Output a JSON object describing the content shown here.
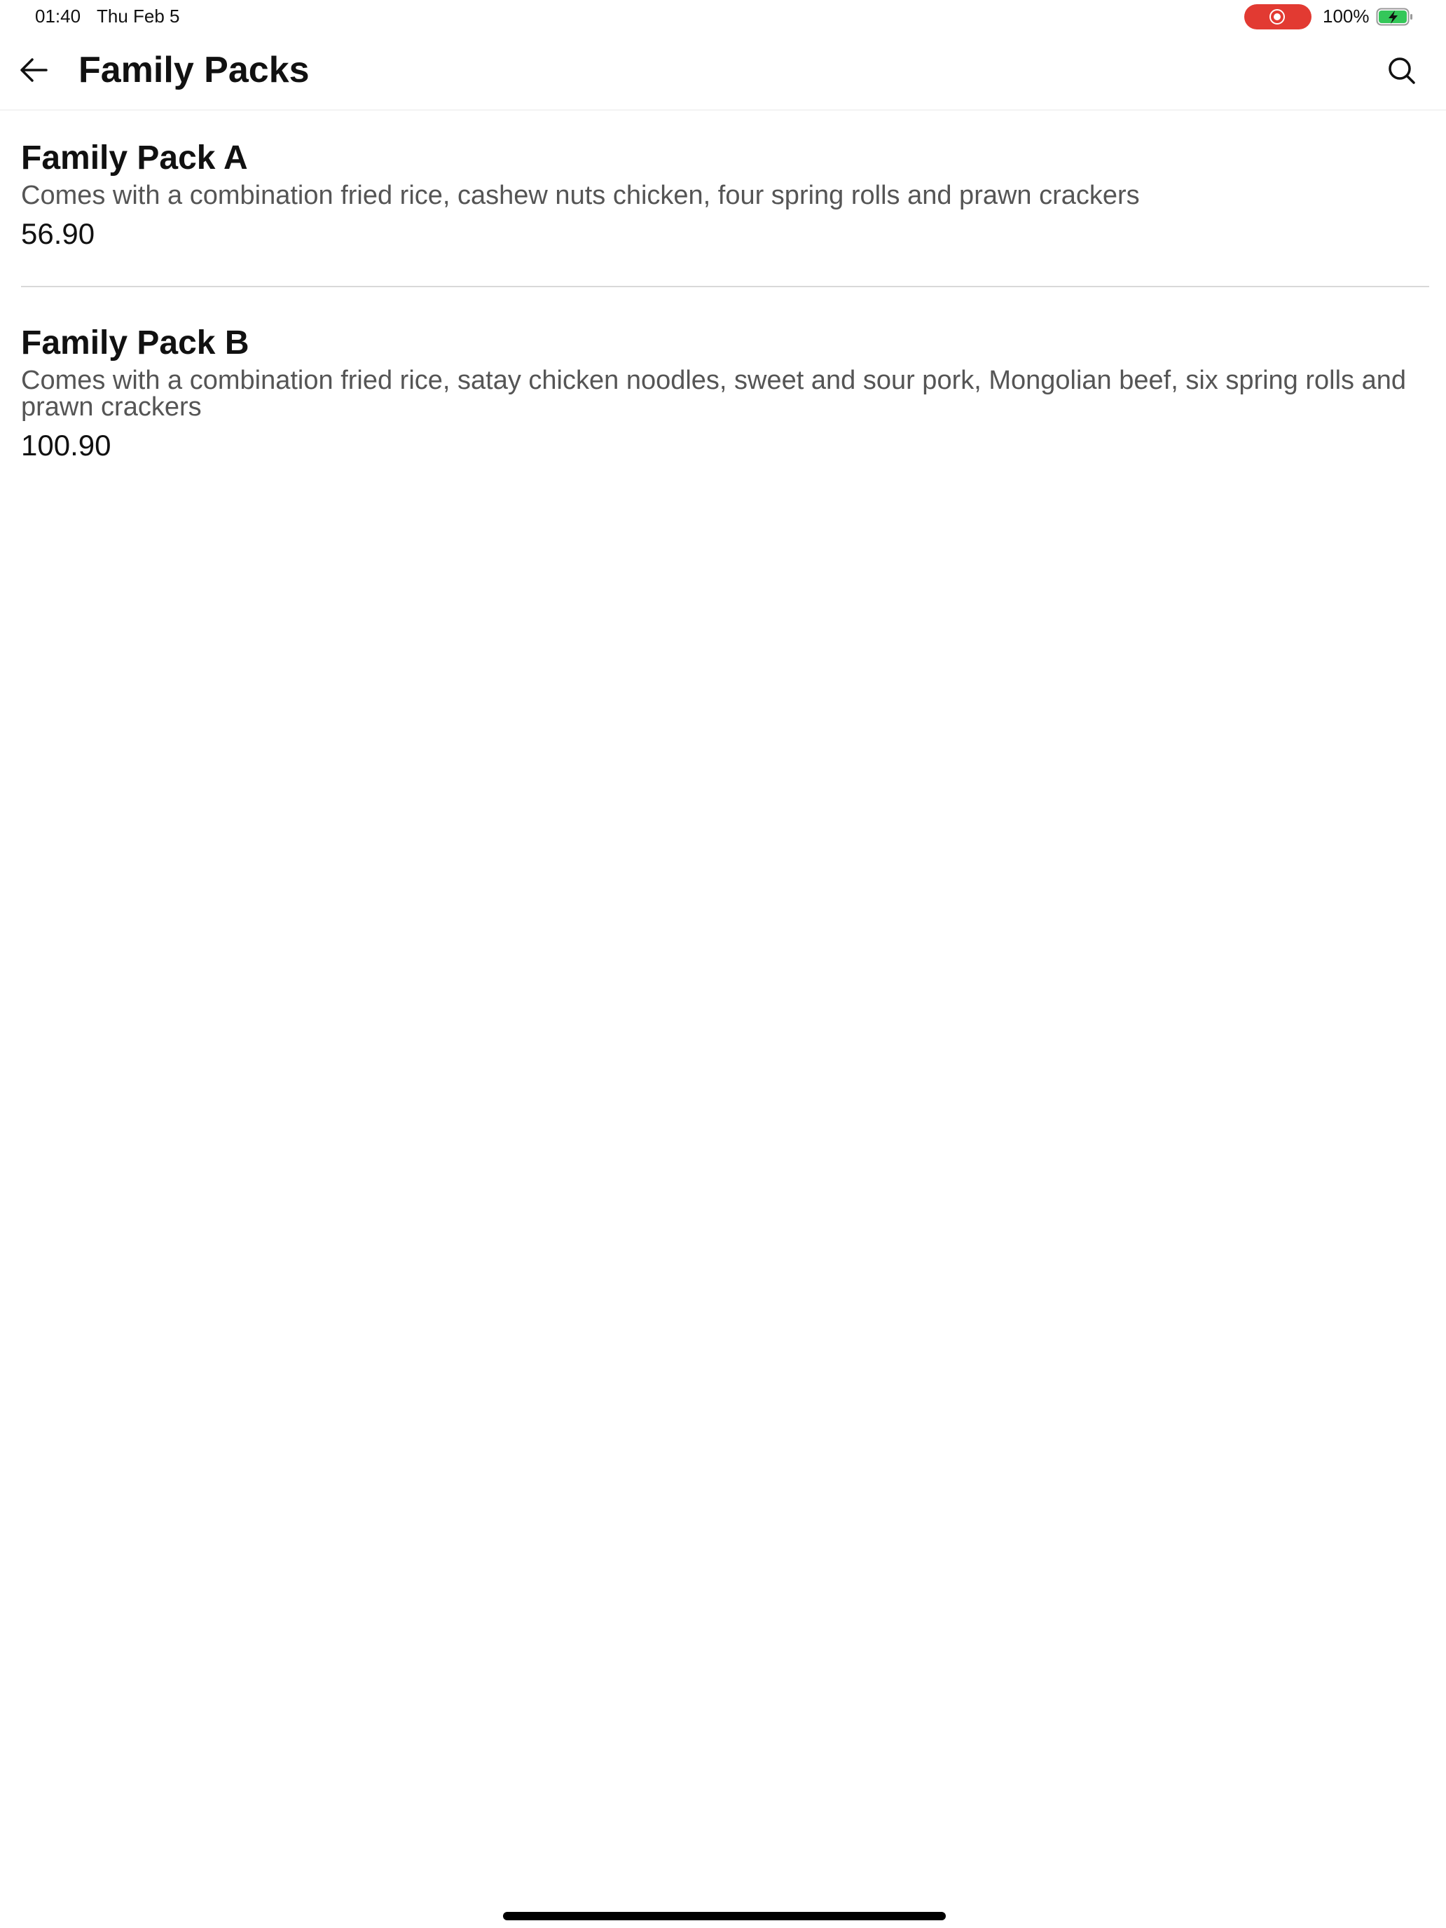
{
  "status_bar": {
    "time": "01:40",
    "date": "Thu Feb 5",
    "battery_percent": "100%",
    "battery_level": 1.0,
    "battery_charging": true,
    "recording_color": "#e23a32",
    "battery_color": "#34c759"
  },
  "app_bar": {
    "title": "Family Packs",
    "back_icon": "arrow-left-icon",
    "search_icon": "search-icon"
  },
  "menu": {
    "items": [
      {
        "name": "Family Pack A",
        "description": "Comes with a combination fried rice, cashew nuts chicken, four spring rolls and prawn crackers",
        "price": "56.90"
      },
      {
        "name": "Family Pack B",
        "description": "Comes with a combination fried rice, satay chicken noodles, sweet and sour pork, Mongolian beef, six spring rolls and prawn crackers",
        "price": "100.90"
      }
    ]
  }
}
